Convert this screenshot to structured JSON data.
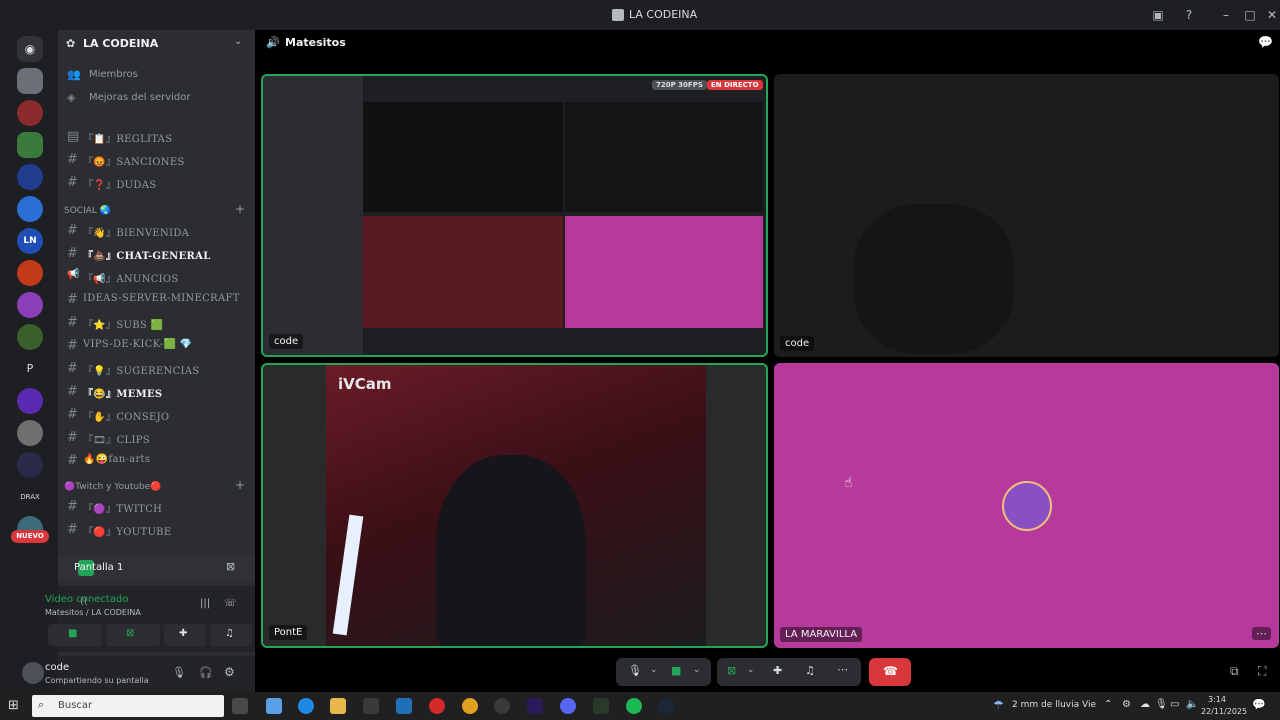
{
  "titlebar": {
    "title": "LA CODEINA"
  },
  "sidebar": {
    "server_name": "LA CODEINA",
    "top_items": [
      {
        "label": "Miembros",
        "icon": "members-icon"
      },
      {
        "label": "Mejoras del servidor",
        "icon": "boost-icon"
      }
    ],
    "channels_a": [
      {
        "label": "『📋』REGLITAS",
        "icon": "rules-icon"
      },
      {
        "label": "『😡』SANCIONES",
        "icon": "hash-icon"
      },
      {
        "label": "『❓』DUDAS",
        "icon": "hash-icon"
      }
    ],
    "social_label": "SOCIAL 🌏",
    "channels_social": [
      {
        "label": "『👋』BIENVENIDA",
        "bright": false
      },
      {
        "label": "『💩』CHAT-GENERAL",
        "bright": true
      },
      {
        "label": "『📢』ANUNCIOS",
        "bright": false
      },
      {
        "label": "IDEAS-SERVER-MINECRAFT",
        "bright": false
      },
      {
        "label": "『⭐』SUBS 🟩",
        "bright": false
      },
      {
        "label": "VIPS-DE-KICK-🟩 💎",
        "bright": false
      },
      {
        "label": "『💡』SUGERENCIAS",
        "bright": false
      },
      {
        "label": "『😂』MEMES",
        "bright": true
      },
      {
        "label": "『✋』CONSEJO",
        "bright": false
      },
      {
        "label": "『🎞』CLIPS",
        "bright": false
      },
      {
        "label": "🔥😜fan-arts",
        "bright": false
      }
    ],
    "twitch_label": "🟣Twitch y Youtube🔴",
    "channels_twitch": [
      {
        "label": "『🟣』TWITCH"
      },
      {
        "label": "『🔴』YOUTUBE"
      }
    ],
    "new_badge": "NUEVO",
    "screen_label": "Pantalla 1",
    "voice_status": "Video conectado",
    "voice_channel": "Matesitos / LA CODEINA",
    "user_name": "code",
    "user_status": "Compartiendo su pantalla"
  },
  "main": {
    "channel_name": "Matesitos",
    "stream_badge_quality": "720P 30FPS",
    "stream_badge_live": "EN DIRECTO",
    "tiles": [
      {
        "label": "code",
        "name": "tile-stream-code"
      },
      {
        "label": "code",
        "name": "tile-cam-code"
      },
      {
        "label": "PontE",
        "name": "tile-cam-ponte"
      },
      {
        "label": "LA MARAVILLA",
        "name": "tile-la-maravilla"
      }
    ],
    "ivcam_label": "iVCam"
  },
  "taskbar": {
    "search_placeholder": "Buscar",
    "weather": "2 mm de lluvia Vie",
    "time": "3:14",
    "date": "22/11/2025"
  },
  "colors": {
    "accent": "#5865f2",
    "green": "#23a559",
    "red": "#da373c",
    "magenta": "#b63a9b"
  }
}
